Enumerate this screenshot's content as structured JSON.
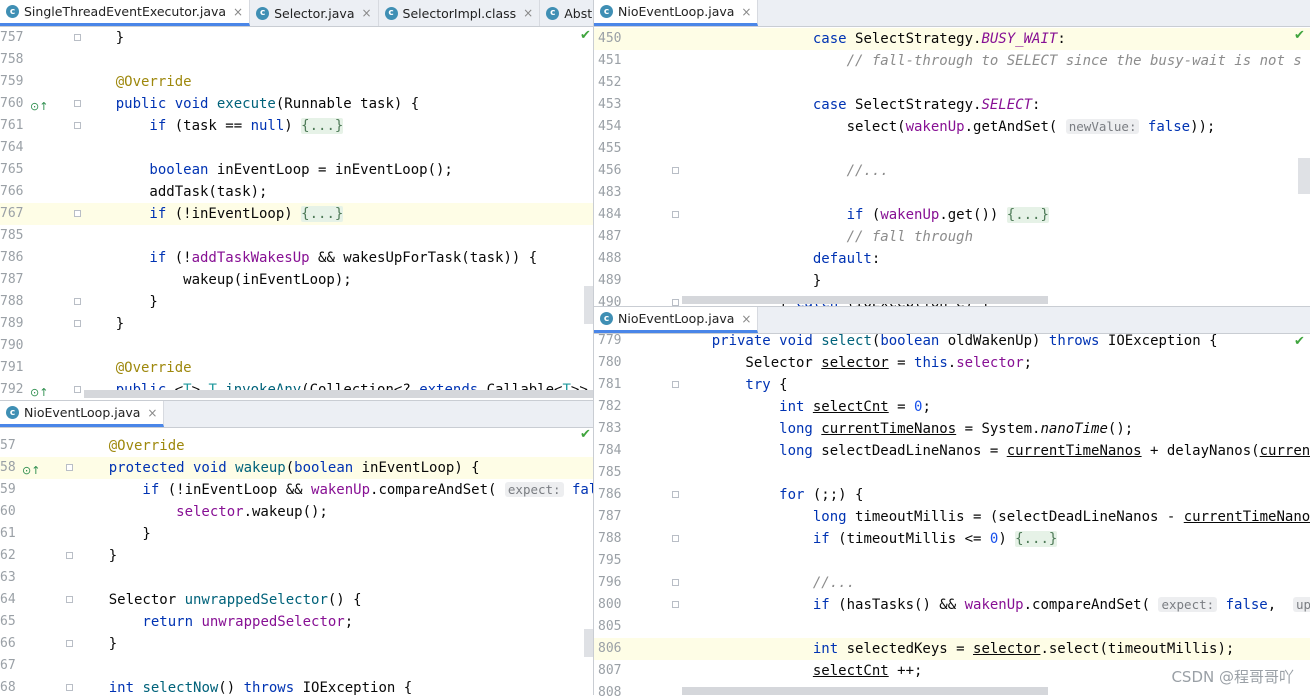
{
  "pane_top_left": {
    "tabs": [
      {
        "label": "SingleThreadEventExecutor.java",
        "active": true,
        "closable": true
      },
      {
        "label": "Selector.java",
        "active": false,
        "closable": true
      },
      {
        "label": "SelectorImpl.class",
        "active": false,
        "closable": true
      },
      {
        "label": "Abstra",
        "active": false,
        "closable": false
      }
    ],
    "lines": [
      {
        "n": "757",
        "seg": [
          [
            "",
            "    }"
          ]
        ]
      },
      {
        "n": "758",
        "seg": []
      },
      {
        "n": "759",
        "seg": [
          [
            "an",
            "    @Override"
          ]
        ]
      },
      {
        "n": "760",
        "seg": [
          [
            "kw",
            "    public void "
          ],
          [
            "mc",
            "execute"
          ],
          [
            "",
            "(Runnable task) {"
          ]
        ]
      },
      {
        "n": "761",
        "seg": [
          [
            "kw",
            "        if "
          ],
          [
            "",
            "(task == "
          ],
          [
            "kw",
            "null"
          ],
          [
            "",
            ") "
          ],
          [
            "fold",
            "{...}"
          ]
        ]
      },
      {
        "n": "764",
        "seg": []
      },
      {
        "n": "765",
        "seg": [
          [
            "kw",
            "        boolean "
          ],
          [
            "",
            "inEventLoop = inEventLoop();"
          ]
        ]
      },
      {
        "n": "766",
        "seg": [
          [
            "",
            "        addTask(task);"
          ]
        ]
      },
      {
        "n": "767",
        "seg": [
          [
            "kw",
            "        if "
          ],
          [
            "",
            "(!inEventLoop) "
          ],
          [
            "fold",
            "{...}"
          ]
        ]
      },
      {
        "n": "785",
        "seg": []
      },
      {
        "n": "786",
        "seg": [
          [
            "kw",
            "        if "
          ],
          [
            "",
            "(!"
          ],
          [
            "fd",
            "addTaskWakesUp"
          ],
          [
            "",
            " && wakesUpForTask(task)) {"
          ]
        ]
      },
      {
        "n": "787",
        "seg": [
          [
            "",
            "            wakeup(inEventLoop);"
          ]
        ]
      },
      {
        "n": "788",
        "seg": [
          [
            "",
            "        }"
          ]
        ]
      },
      {
        "n": "789",
        "seg": [
          [
            "",
            "    }"
          ]
        ]
      },
      {
        "n": "790",
        "seg": []
      },
      {
        "n": "791",
        "seg": [
          [
            "an",
            "    @Override"
          ]
        ]
      },
      {
        "n": "792",
        "seg": [
          [
            "kw",
            "    public "
          ],
          [
            "",
            "<"
          ],
          [
            "tp",
            "T"
          ],
          [
            "",
            "> "
          ],
          [
            "tp",
            "T "
          ],
          [
            "mc",
            "invokeAny"
          ],
          [
            "",
            "(Collection<? "
          ],
          [
            "kw",
            "extends "
          ],
          [
            "",
            "Callable<"
          ],
          [
            "tp",
            "T"
          ],
          [
            "",
            ">> tas"
          ]
        ]
      }
    ]
  },
  "pane_bottom_left": {
    "tabs": [
      {
        "label": "NioEventLoop.java",
        "active": true,
        "closable": true
      }
    ],
    "lines": [
      {
        "n": "57",
        "seg": [
          [
            "an",
            "    @Override"
          ]
        ]
      },
      {
        "n": "58",
        "seg": [
          [
            "kw",
            "    protected void "
          ],
          [
            "mc",
            "wakeup"
          ],
          [
            "",
            "("
          ],
          [
            "kw",
            "boolean "
          ],
          [
            "",
            "inEventLoop) {"
          ]
        ]
      },
      {
        "n": "59",
        "seg": [
          [
            "kw",
            "        if "
          ],
          [
            "",
            "(!inEventLoop && "
          ],
          [
            "fd",
            "wakenUp"
          ],
          [
            "",
            ".compareAndSet( "
          ],
          [
            "hint",
            "expect:"
          ],
          [
            "kw",
            " false"
          ],
          [
            "",
            ","
          ]
        ]
      },
      {
        "n": "60",
        "seg": [
          [
            "fd",
            "            selector"
          ],
          [
            "",
            ".wakeup();"
          ]
        ]
      },
      {
        "n": "61",
        "seg": [
          [
            "",
            "        }"
          ]
        ]
      },
      {
        "n": "62",
        "seg": [
          [
            "",
            "    }"
          ]
        ]
      },
      {
        "n": "63",
        "seg": []
      },
      {
        "n": "64",
        "seg": [
          [
            "",
            "    Selector "
          ],
          [
            "mc",
            "unwrappedSelector"
          ],
          [
            "",
            "() {"
          ]
        ]
      },
      {
        "n": "65",
        "seg": [
          [
            "kw",
            "        return "
          ],
          [
            "fd",
            "unwrappedSelector"
          ],
          [
            "",
            ";"
          ]
        ]
      },
      {
        "n": "66",
        "seg": [
          [
            "",
            "    }"
          ]
        ]
      },
      {
        "n": "67",
        "seg": []
      },
      {
        "n": "68",
        "seg": [
          [
            "kw",
            "    int "
          ],
          [
            "mc",
            "selectNow"
          ],
          [
            "",
            "() "
          ],
          [
            "kw",
            "throws "
          ],
          [
            "",
            "IOException {"
          ]
        ]
      }
    ]
  },
  "pane_top_right": {
    "tabs": [
      {
        "label": "NioEventLoop.java",
        "active": true,
        "closable": true
      }
    ],
    "lines": [
      {
        "n": "450",
        "seg": [
          [
            "kw",
            "                case "
          ],
          [
            "",
            "SelectStrategy."
          ],
          [
            "ist",
            "BUSY_WAIT"
          ],
          [
            "",
            ":"
          ]
        ]
      },
      {
        "n": "451",
        "seg": [
          [
            "cm",
            "                    // fall-through to SELECT since the busy-wait is not s"
          ]
        ]
      },
      {
        "n": "452",
        "seg": []
      },
      {
        "n": "453",
        "seg": [
          [
            "kw",
            "                case "
          ],
          [
            "",
            "SelectStrategy."
          ],
          [
            "ist",
            "SELECT"
          ],
          [
            "",
            ":"
          ]
        ]
      },
      {
        "n": "454",
        "seg": [
          [
            "",
            "                    select("
          ],
          [
            "fd",
            "wakenUp"
          ],
          [
            "",
            ".getAndSet( "
          ],
          [
            "hint",
            "newValue:"
          ],
          [
            "kw",
            " false"
          ],
          [
            "",
            "));"
          ]
        ]
      },
      {
        "n": "455",
        "seg": []
      },
      {
        "n": "456",
        "seg": [
          [
            "cm",
            "                    //..."
          ]
        ]
      },
      {
        "n": "483",
        "seg": []
      },
      {
        "n": "484",
        "seg": [
          [
            "kw",
            "                    if "
          ],
          [
            "",
            "("
          ],
          [
            "fd",
            "wakenUp"
          ],
          [
            "",
            ".get()) "
          ],
          [
            "fold",
            "{...}"
          ]
        ]
      },
      {
        "n": "487",
        "seg": [
          [
            "cm",
            "                    // fall through"
          ]
        ]
      },
      {
        "n": "488",
        "seg": [
          [
            "kw",
            "                default"
          ],
          [
            "",
            ":"
          ]
        ]
      },
      {
        "n": "489",
        "seg": [
          [
            "",
            "                }"
          ]
        ]
      },
      {
        "n": "490",
        "seg": [
          [
            "",
            "            } "
          ],
          [
            "kw",
            "catch "
          ],
          [
            "",
            "(IOException e) {"
          ]
        ]
      }
    ]
  },
  "pane_bottom_right": {
    "tabs": [
      {
        "label": "NioEventLoop.java",
        "active": true,
        "closable": true
      }
    ],
    "lines": [
      {
        "n": "779",
        "seg": [
          [
            "kw",
            "    private void "
          ],
          [
            "mc",
            "select"
          ],
          [
            "",
            "("
          ],
          [
            "kw",
            "boolean "
          ],
          [
            "",
            "oldWakenUp) "
          ],
          [
            "kw",
            "throws "
          ],
          [
            "",
            "IOException {"
          ]
        ]
      },
      {
        "n": "780",
        "seg": [
          [
            "",
            "        Selector "
          ],
          [
            "ul",
            "selector"
          ],
          [
            "",
            " = "
          ],
          [
            "kw",
            "this"
          ],
          [
            "",
            "."
          ],
          [
            "fd",
            "selector"
          ],
          [
            "",
            ";"
          ]
        ]
      },
      {
        "n": "781",
        "seg": [
          [
            "kw",
            "        try "
          ],
          [
            "",
            "{"
          ]
        ]
      },
      {
        "n": "782",
        "seg": [
          [
            "kw",
            "            int "
          ],
          [
            "ul",
            "selectCnt"
          ],
          [
            "",
            " = "
          ],
          [
            "num",
            "0"
          ],
          [
            "",
            ";"
          ]
        ]
      },
      {
        "n": "783",
        "seg": [
          [
            "kw",
            "            long "
          ],
          [
            "ul",
            "currentTimeNanos"
          ],
          [
            "",
            " = System."
          ],
          [
            "it",
            "nanoTime"
          ],
          [
            "",
            "();"
          ]
        ]
      },
      {
        "n": "784",
        "seg": [
          [
            "kw",
            "            long "
          ],
          [
            "",
            "selectDeadLineNanos = "
          ],
          [
            "ul",
            "currentTimeNanos"
          ],
          [
            "",
            " + delayNanos("
          ],
          [
            "ul",
            "currentTi"
          ]
        ]
      },
      {
        "n": "785",
        "seg": []
      },
      {
        "n": "786",
        "seg": [
          [
            "kw",
            "            for "
          ],
          [
            "",
            "(;;) {"
          ]
        ]
      },
      {
        "n": "787",
        "seg": [
          [
            "kw",
            "                long "
          ],
          [
            "",
            "timeoutMillis = (selectDeadLineNanos - "
          ],
          [
            "ul",
            "currentTimeNanos"
          ],
          [
            "",
            " +"
          ]
        ]
      },
      {
        "n": "788",
        "seg": [
          [
            "kw",
            "                if "
          ],
          [
            "",
            "(timeoutMillis <= "
          ],
          [
            "num",
            "0"
          ],
          [
            "",
            ") "
          ],
          [
            "fold",
            "{...}"
          ]
        ]
      },
      {
        "n": "795",
        "seg": []
      },
      {
        "n": "796",
        "seg": [
          [
            "cm",
            "                //..."
          ]
        ]
      },
      {
        "n": "800",
        "seg": [
          [
            "kw",
            "                if "
          ],
          [
            "",
            "(hasTasks() && "
          ],
          [
            "fd",
            "wakenUp"
          ],
          [
            "",
            ".compareAndSet( "
          ],
          [
            "hint",
            "expect:"
          ],
          [
            "kw",
            " false"
          ],
          [
            "",
            ",  "
          ],
          [
            "hint",
            "update:"
          ],
          [
            "",
            " t"
          ]
        ]
      },
      {
        "n": "805",
        "seg": []
      },
      {
        "n": "806",
        "seg": [
          [
            "kw",
            "                int "
          ],
          [
            "",
            "selectedKeys = "
          ],
          [
            "ul",
            "selector"
          ],
          [
            "",
            ".select(timeoutMillis);"
          ]
        ]
      },
      {
        "n": "807",
        "seg": [
          [
            "",
            "                "
          ],
          [
            "ul",
            "selectCnt"
          ],
          [
            "",
            " ++;"
          ]
        ]
      },
      {
        "n": "808",
        "seg": []
      }
    ]
  },
  "watermark": "CSDN @程哥哥吖",
  "icons": {
    "java_file": "class-file-icon",
    "ok": "checkmark-icon"
  },
  "colors": {
    "keyword": "#0033b3",
    "annotation": "#9e880d",
    "comment": "#8c8c8c",
    "field": "#871094",
    "method": "#00627a",
    "number": "#1750eb"
  }
}
